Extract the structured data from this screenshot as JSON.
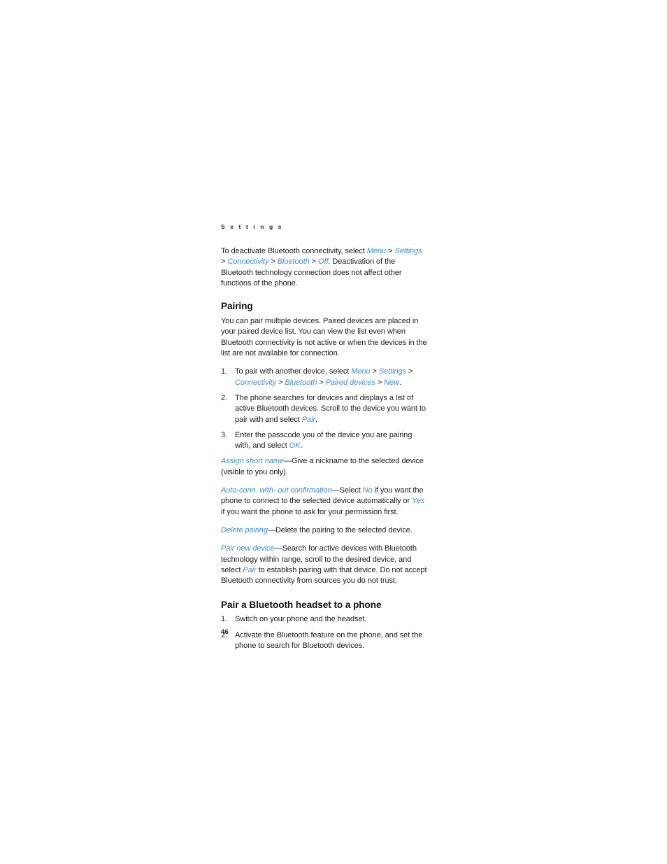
{
  "document": {
    "running_head": "S e t t i n g s",
    "page_number": "46",
    "link_color": "#3b8ed0",
    "text_color": "#1d1d1d"
  },
  "intro": {
    "p1_a": "To deactivate Bluetooth connectivity, select ",
    "p1_menu": "Menu",
    "p1_sep1": " > ",
    "p1_settings": "Settings",
    "p1_sep2": " > ",
    "p1_connectivity": "Connectivity",
    "p1_sep3": " > ",
    "p1_bluetooth": "Bluetooth",
    "p1_sep4": " > ",
    "p1_off": "Off",
    "p1_b": ". Deactivation of the Bluetooth technology connection does not affect other functions of the phone."
  },
  "pairing": {
    "heading": "Pairing",
    "intro": "You can pair multiple devices. Paired devices are placed in your paired device list. You can view the list even when Bluetooth connectivity is not active or when the devices in the list are not available for connection.",
    "steps": [
      {
        "num": "1.",
        "text_a": "To pair with another device, select ",
        "ui_1": "Menu",
        "sep_1": " > ",
        "ui_2": "Settings",
        "sep_2": " > ",
        "ui_3": "Connectivity",
        "sep_3": " > ",
        "ui_4": "Bluetooth",
        "sep_4": " > ",
        "ui_5": "Paired devices",
        "sep_5": " > ",
        "ui_6": "New",
        "text_b": "."
      },
      {
        "num": "2.",
        "text_a": "The phone searches for devices and displays a list of active Bluetooth devices. Scroll to the device you want to pair with and select ",
        "ui_1": "Pair",
        "text_b": "."
      },
      {
        "num": "3.",
        "text_a": "Enter the passcode you of the device you are pairing with, and select ",
        "ui_1": "OK",
        "text_b": "."
      }
    ],
    "definitions": [
      {
        "term": "Assign short name",
        "dash": "—",
        "body_a": "Give a nickname to the selected device (visible to you only)."
      },
      {
        "term": "Auto-conn. with- out confirmation",
        "dash": "—",
        "body_a": "Select ",
        "ui_1": "No",
        "body_b": " if you want the phone to connect to the selected device automatically or ",
        "ui_2": "Yes",
        "body_c": " if you want the phone to ask for your permission first."
      },
      {
        "term": "Delete pairing",
        "dash": "—",
        "body_a": "Delete the pairing to the selected device."
      },
      {
        "term": "Pair new device",
        "dash": "—",
        "body_a": "Search for active devices with Bluetooth technology within range, scroll to the desired device, and select ",
        "ui_1": "Pair",
        "body_b": " to establish pairing with that device. Do not accept Bluetooth connectivity from sources you do not trust."
      }
    ]
  },
  "headset": {
    "heading": "Pair a Bluetooth headset to a phone",
    "steps": [
      {
        "num": "1.",
        "text": "Switch on your phone and the headset."
      },
      {
        "num": "2.",
        "text": "Activate the Bluetooth feature on the phone, and set the phone to search for Bluetooth devices."
      }
    ]
  }
}
